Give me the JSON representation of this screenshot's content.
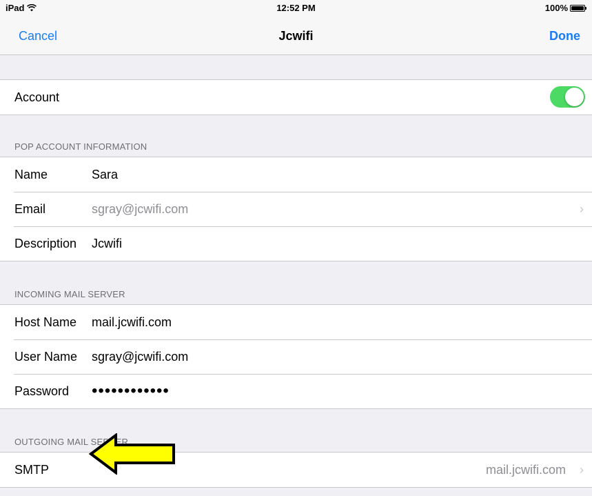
{
  "status_bar": {
    "device": "iPad",
    "time": "12:52 PM",
    "battery_percent": "100%"
  },
  "nav": {
    "cancel_label": "Cancel",
    "title": "Jcwifi",
    "done_label": "Done"
  },
  "account": {
    "label": "Account",
    "enabled": true
  },
  "pop_section": {
    "header": "POP ACCOUNT INFORMATION",
    "name_label": "Name",
    "name_value": "Sara",
    "email_label": "Email",
    "email_value": "sgray@jcwifi.com",
    "description_label": "Description",
    "description_value": "Jcwifi"
  },
  "incoming_section": {
    "header": "INCOMING MAIL SERVER",
    "host_label": "Host Name",
    "host_value": "mail.jcwifi.com",
    "user_label": "User Name",
    "user_value": "sgray@jcwifi.com",
    "password_label": "Password",
    "password_value": "••••••••••••"
  },
  "outgoing_section": {
    "header": "OUTGOING MAIL SERVER",
    "smtp_label": "SMTP",
    "smtp_value": "mail.jcwifi.com"
  },
  "colors": {
    "accent": "#1a7cf5",
    "toggle_on": "#4cd964",
    "annotation_arrow": "#ffff00"
  },
  "icons": {
    "wifi": "wifi-icon",
    "battery": "battery-icon",
    "chevron": "chevron-right-icon",
    "annotation": "arrow-left-icon"
  }
}
